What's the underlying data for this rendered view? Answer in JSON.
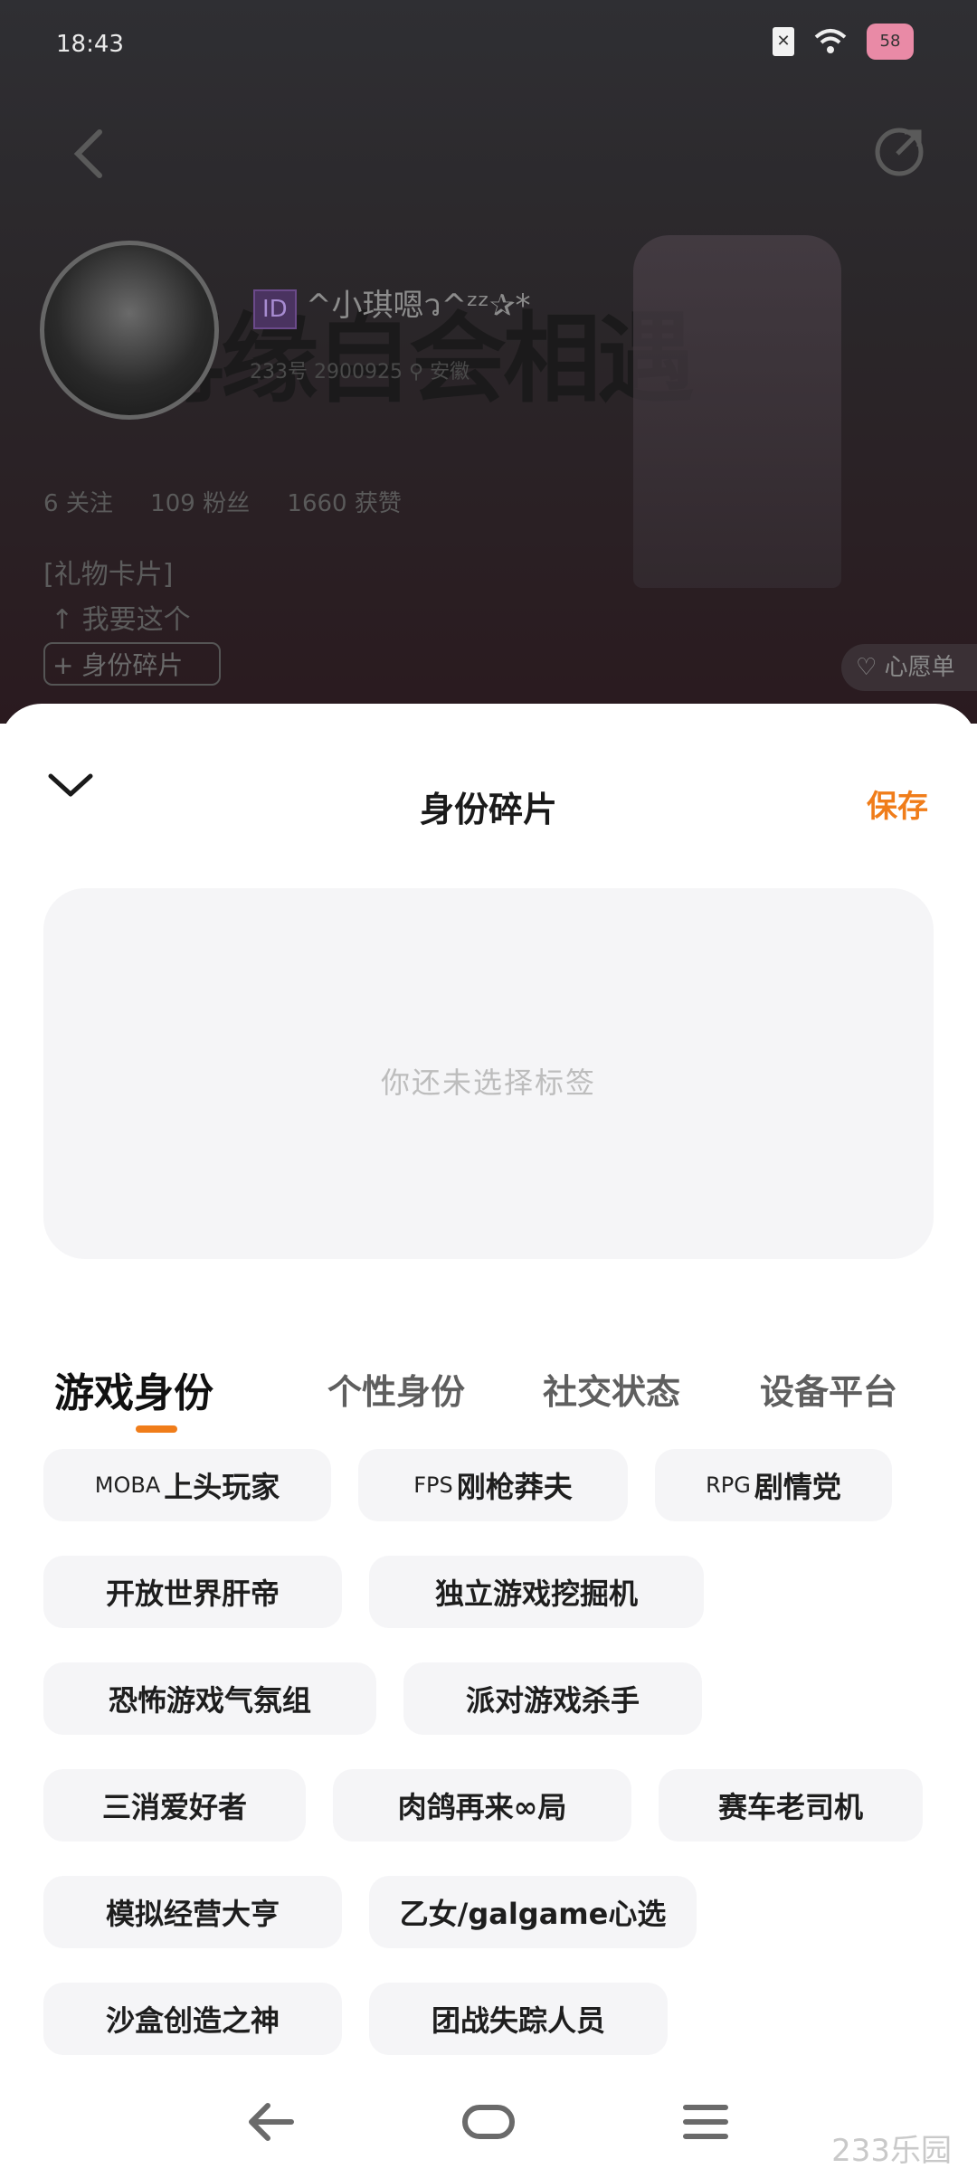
{
  "status_bar": {
    "time": "18:43",
    "battery": "58"
  },
  "profile": {
    "id_badge": "ID",
    "nickname": "^小琪嗯ว^ᶻᶻ✰*",
    "banner_text": "再缘自会相遇",
    "uid": "233号 2900925",
    "location": "安徽",
    "stats": [
      {
        "value": "6",
        "label": "关注"
      },
      {
        "value": "109",
        "label": "粉丝"
      },
      {
        "value": "1660",
        "label": "获赞"
      }
    ],
    "gift_card": "[礼物卡片]",
    "want_this": "↑ 我要这个",
    "identity_button": "+ 身份碎片",
    "wishlist": "心愿单"
  },
  "sheet": {
    "title": "身份碎片",
    "save_label": "保存",
    "empty_text": "你还未选择标签",
    "tabs": [
      {
        "label": "游戏身份",
        "active": true
      },
      {
        "label": "个性身份",
        "active": false
      },
      {
        "label": "社交状态",
        "active": false
      },
      {
        "label": "设备平台",
        "active": false
      }
    ],
    "tags": [
      {
        "prefix": "MOBA",
        "label": "上头玩家"
      },
      {
        "prefix": "FPS",
        "label": "刚枪莽夫"
      },
      {
        "prefix": "RPG",
        "label": "剧情党"
      },
      {
        "prefix": "",
        "label": "开放世界肝帝"
      },
      {
        "prefix": "",
        "label": "独立游戏挖掘机"
      },
      {
        "prefix": "",
        "label": "恐怖游戏气氛组"
      },
      {
        "prefix": "",
        "label": "派对游戏杀手"
      },
      {
        "prefix": "",
        "label": "三消爱好者"
      },
      {
        "prefix": "",
        "label": "肉鸽再来∞局"
      },
      {
        "prefix": "",
        "label": "赛车老司机"
      },
      {
        "prefix": "",
        "label": "模拟经营大亨"
      },
      {
        "prefix": "",
        "label": "乙女/galgame心选"
      },
      {
        "prefix": "",
        "label": "沙盒创造之神"
      },
      {
        "prefix": "",
        "label": "团战失踪人员"
      }
    ]
  },
  "watermark": "233乐园",
  "colors": {
    "accent": "#f07d1a",
    "chip_bg": "#f5f5f7"
  }
}
